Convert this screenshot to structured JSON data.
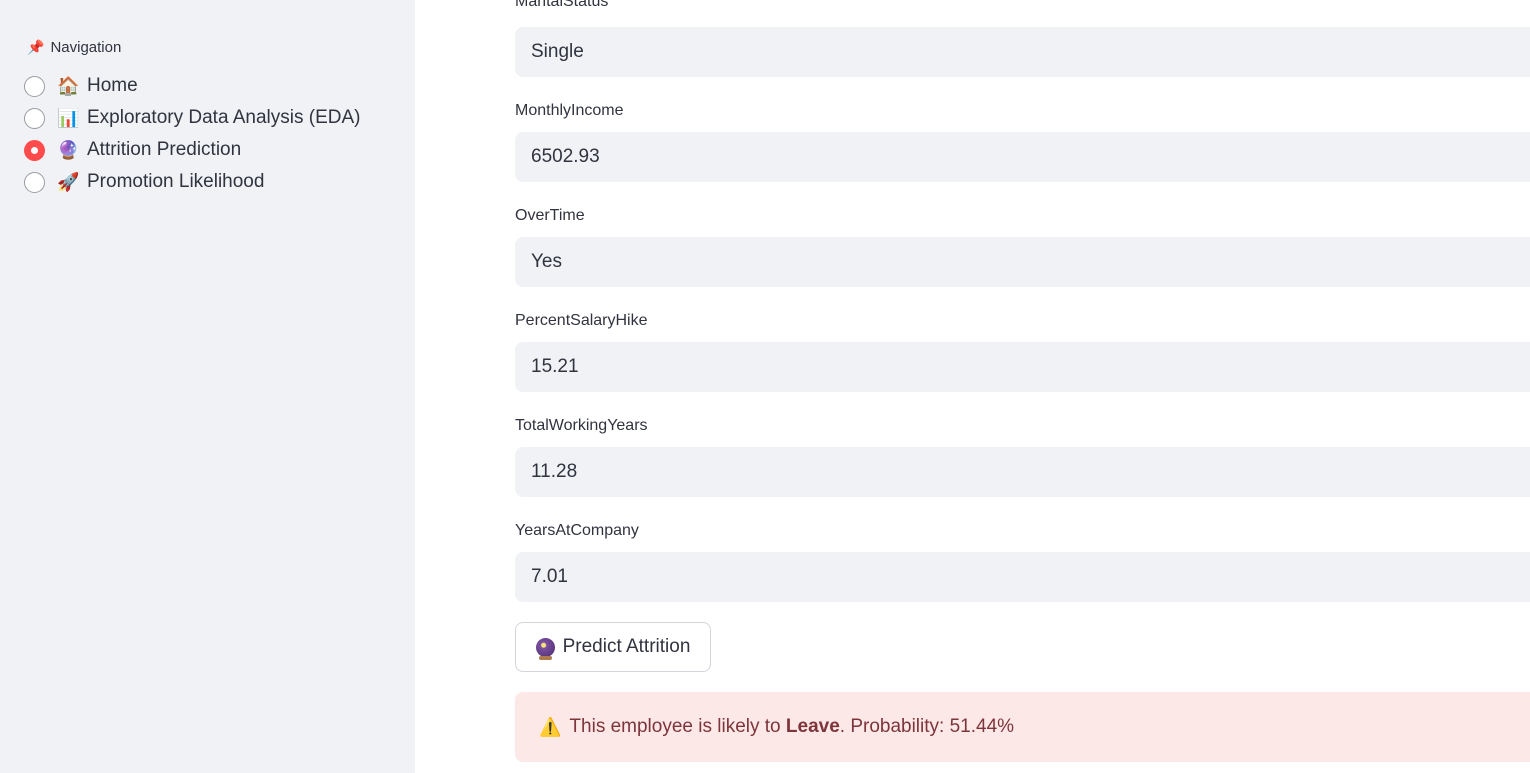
{
  "sidebar": {
    "title": "Navigation",
    "title_icon": "pushpin-icon",
    "items": [
      {
        "emoji": "🏠",
        "icon": "house-icon",
        "label": "Home",
        "selected": false
      },
      {
        "emoji": "📊",
        "icon": "bar-chart-icon",
        "label": "Exploratory Data Analysis (EDA)",
        "selected": false
      },
      {
        "emoji": "🔮",
        "icon": "crystal-ball-icon",
        "label": "Attrition Prediction",
        "selected": true
      },
      {
        "emoji": "🚀",
        "icon": "rocket-icon",
        "label": "Promotion Likelihood",
        "selected": false
      }
    ]
  },
  "form": {
    "fields": [
      {
        "label": "MaritalStatus",
        "value": "Single"
      },
      {
        "label": "MonthlyIncome",
        "value": "6502.93"
      },
      {
        "label": "OverTime",
        "value": "Yes"
      },
      {
        "label": "PercentSalaryHike",
        "value": "15.21"
      },
      {
        "label": "TotalWorkingYears",
        "value": "11.28"
      },
      {
        "label": "YearsAtCompany",
        "value": "7.01"
      }
    ],
    "predict_button": {
      "icon": "crystal-ball-icon",
      "label": "Predict Attrition"
    }
  },
  "result": {
    "icon": "warning-icon",
    "prefix": "This employee is likely to ",
    "emphasis": "Leave",
    "suffix": ". Probability: 51.44%"
  },
  "colors": {
    "accent": "#ff4b4b",
    "sidebar_bg": "#f0f2f6",
    "alert_bg": "#fde8e8",
    "alert_text": "#7d353b"
  }
}
